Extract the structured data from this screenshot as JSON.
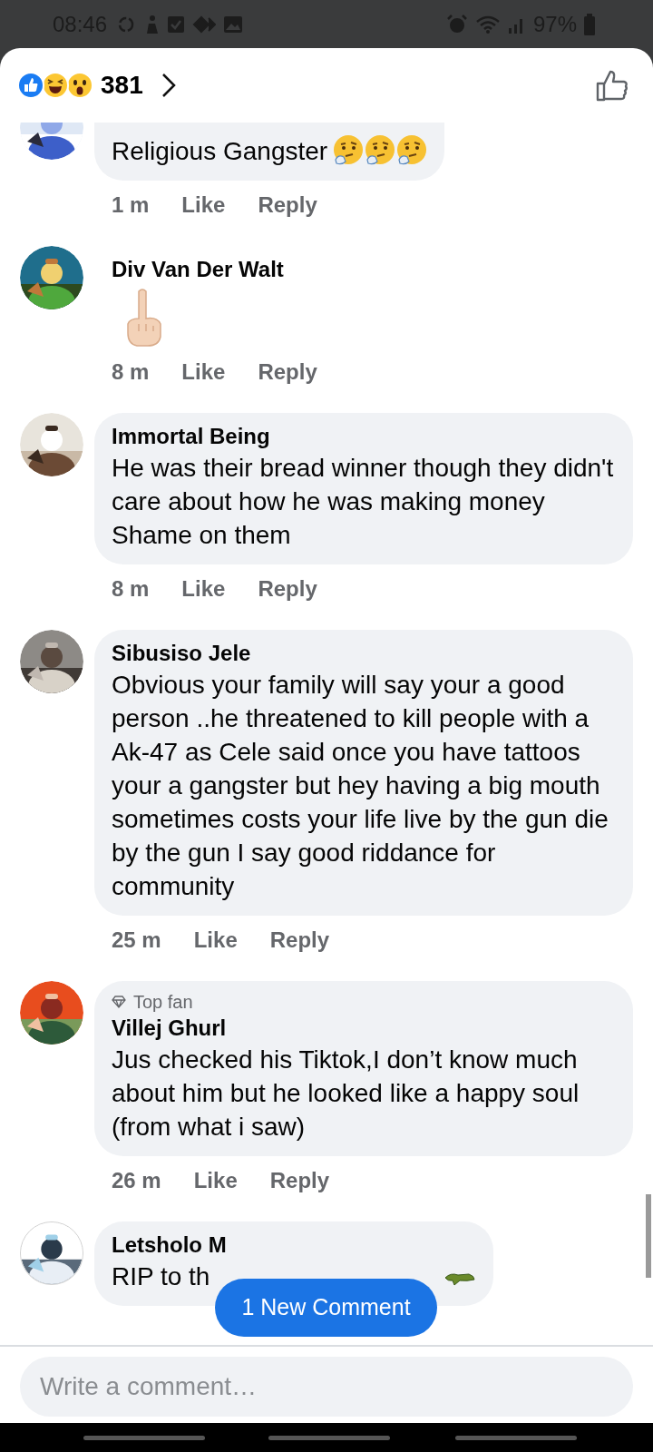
{
  "status_bar": {
    "time": "08:46",
    "battery": "97%"
  },
  "header": {
    "reaction_count": "381"
  },
  "comments": [
    {
      "kind": "thinking",
      "text": "Religious Gangster",
      "time": "1 m",
      "like": "Like",
      "reply": "Reply"
    },
    {
      "kind": "gesture",
      "name": "Div Van Der Walt",
      "time": "8 m",
      "like": "Like",
      "reply": "Reply"
    },
    {
      "kind": "plain",
      "name": "Immortal Being",
      "text": "He was their bread winner though they didn't care about how he was making money\nShame on them",
      "time": "8 m",
      "like": "Like",
      "reply": "Reply"
    },
    {
      "kind": "plain",
      "name": "Sibusiso Jele",
      "text": "Obvious your family will say your a good person ..he threatened to kill people with a Ak-47 as Cele said once you have tattoos your a gangster but hey having a big mouth sometimes costs your life live by the gun die by the gun I say good riddance for community",
      "time": "25 m",
      "like": "Like",
      "reply": "Reply"
    },
    {
      "kind": "plain",
      "badge": "Top fan",
      "name": "Villej Ghurl",
      "text": "Jus checked his Tiktok,I don’t know much about him but he looked like a happy soul (from what i saw)",
      "time": "26 m",
      "like": "Like",
      "reply": "Reply"
    },
    {
      "kind": "crocodile",
      "name": "Letsholo M",
      "text": "RIP to th"
    }
  ],
  "new_comment_pill": "1 New Comment",
  "composer": {
    "placeholder": "Write a comment…"
  }
}
